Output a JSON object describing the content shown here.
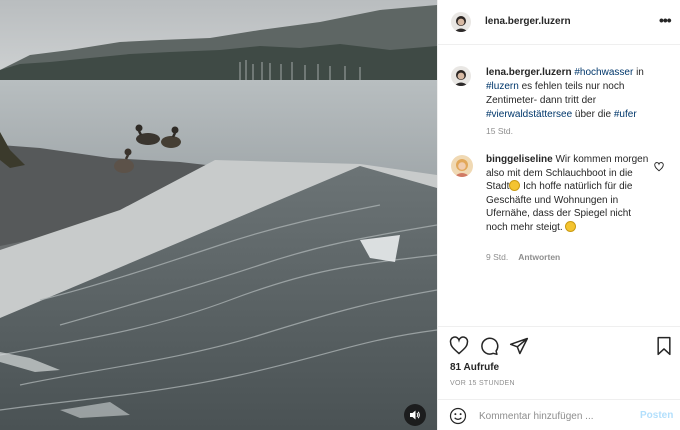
{
  "post": {
    "author": "lena.berger.luzern",
    "more_icon": "more-horizontal-icon",
    "sound_icon": "speaker-icon"
  },
  "caption": {
    "user": "lena.berger.luzern",
    "parts": [
      {
        "text": " ",
        "tag": false
      },
      {
        "text": "#hochwasser",
        "tag": true
      },
      {
        "text": " in ",
        "tag": false
      },
      {
        "text": "#luzern",
        "tag": true
      },
      {
        "text": " es fehlen teils nur noch Zentimeter- dann tritt der ",
        "tag": false
      },
      {
        "text": "#vierwaldstättersee",
        "tag": true
      },
      {
        "text": " über die ",
        "tag": false
      },
      {
        "text": "#ufer",
        "tag": true
      }
    ],
    "time": "15 Std."
  },
  "comment": {
    "user": "binggeliseline",
    "text_1": " Wir kommen morgen also mit dem Schlauchboot in die Stadt",
    "text_2": " Ich hoffe natürlich für die Geschäfte und Wohnungen in Ufernähe, dass der Spiegel nicht noch mehr steigt. ",
    "time": "9 Std.",
    "reply_label": "Antworten"
  },
  "actions": {
    "icons": [
      "heart-icon",
      "comment-icon",
      "share-icon",
      "bookmark-icon"
    ],
    "views": "81 Aufrufe",
    "posted": "VOR 15 STUNDEN"
  },
  "comment_box": {
    "placeholder": "Kommentar hinzufügen ...",
    "post_label": "Posten",
    "post_color": "#b2dffc"
  }
}
